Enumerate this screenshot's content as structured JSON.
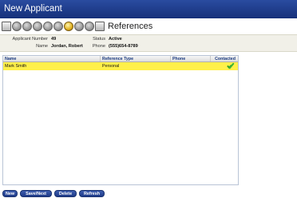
{
  "window": {
    "title": "New Applicant"
  },
  "toolbar": {
    "title": "References",
    "icons": [
      "print-icon",
      "disc-icon",
      "disc-icon",
      "phone-icon",
      "disc-icon",
      "disc-icon",
      "key-icon",
      "phone-icon",
      "disc-icon",
      "document-icon"
    ]
  },
  "info": {
    "applicant_number_label": "Applicant Number",
    "applicant_number": "49",
    "name_label": "Name",
    "name": "Jordan, Robert",
    "status_label": "Status",
    "status": "Active",
    "phone_label": "Phone",
    "phone": "(555)654-8789"
  },
  "grid": {
    "columns": [
      "Name",
      "Reference Type",
      "Phone",
      "Contacted"
    ],
    "rows": [
      {
        "name": "Mark Smith",
        "type": "Personal",
        "phone": "",
        "contacted": true
      }
    ]
  },
  "buttons": {
    "new": "New",
    "save_next": "Save/Next",
    "delete": "Delete",
    "refresh": "Refresh"
  },
  "colors": {
    "title_bar": "#1d3a8a",
    "selected_row": "#fff04a",
    "check": "#2fa12a"
  }
}
